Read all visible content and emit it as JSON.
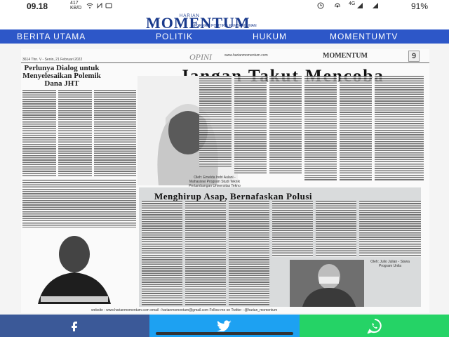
{
  "status_bar": {
    "time": "09.18",
    "speed_value": "417",
    "speed_unit": "KB/D",
    "signal_label": "4G",
    "battery": "91%"
  },
  "header": {
    "logo_top": "HARIAN",
    "logo_main": "MOMENTUM",
    "logo_tagline": "INFORMASI POLITIK & PEMBANGUNAN"
  },
  "nav": {
    "items": [
      "BERITA UTAMA",
      "POLITIK",
      "HUKUM",
      "MOMENTUMTV"
    ]
  },
  "paper": {
    "edition": "3614 Thn. V - Senin, 21 Februari 2022",
    "section": "OPINI",
    "website": "www.harianmomentum.com",
    "logo": "MOMENTUM",
    "page_number": "9",
    "left_headline": "Perlunya Dialog untuk Menyelesaikan Polemik Dana JHT",
    "main_headline": "Jangan Takut Mencoba",
    "caption1": "Oleh: Emelda Indri Aulani - Mahasiswi Program Studi Teknik Pertambangan Universitas Tekno Sumatera",
    "second_headline": "Menghirup Asap, Bernafaskan Polusi",
    "caption2": "Oleh: Julio Julian - Siswa Program Unila",
    "footer": "website : www.harianmomentum.com    email : harianmomentum@gmail.com    Follow me on Twitter : @harian_momentum"
  },
  "share": {
    "buttons": [
      {
        "name": "facebook",
        "icon": "f",
        "color": "#3b5998"
      },
      {
        "name": "twitter",
        "icon": "twitter-bird",
        "color": "#1da1f2"
      },
      {
        "name": "whatsapp",
        "icon": "whatsapp",
        "color": "#25d366"
      }
    ]
  },
  "colors": {
    "nav": "#2d57c8",
    "brand": "#1a3a8c"
  }
}
